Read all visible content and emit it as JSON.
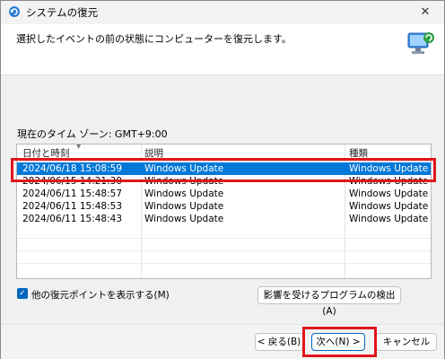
{
  "window": {
    "title": "システムの復元",
    "close_symbol": "✕"
  },
  "header": {
    "instruction": "選択したイベントの前の状態にコンピューターを復元します。"
  },
  "timezone": {
    "label": "現在のタイム ゾーン: GMT+9:00"
  },
  "restore_list": {
    "columns": [
      "日付と時刻",
      "説明",
      "種類"
    ],
    "rows": [
      {
        "datetime": "2024/06/18 15:08:59",
        "description": "Windows Update",
        "type": "Windows Update",
        "selected": true
      },
      {
        "datetime": "2024/06/15 14:21:30",
        "description": "Windows Update",
        "type": "Windows Update",
        "selected": false
      },
      {
        "datetime": "2024/06/11 15:48:57",
        "description": "Windows Update",
        "type": "Windows Update",
        "selected": false
      },
      {
        "datetime": "2024/06/11 15:48:53",
        "description": "Windows Update",
        "type": "Windows Update",
        "selected": false
      },
      {
        "datetime": "2024/06/11 15:48:43",
        "description": "Windows Update",
        "type": "Windows Update",
        "selected": false
      }
    ]
  },
  "options": {
    "show_more_label": "他の復元ポイントを表示する(M)",
    "show_more_checked": true,
    "scan_programs_label": "影響を受けるプログラムの検出(A)"
  },
  "footer": {
    "back_label": "< 戻る(B)",
    "next_label": "次へ(N) >",
    "cancel_label": "キャンセル"
  },
  "colors": {
    "selection": "#0078d7",
    "highlight_box": "#e0161c",
    "accent": "#0067c0"
  }
}
